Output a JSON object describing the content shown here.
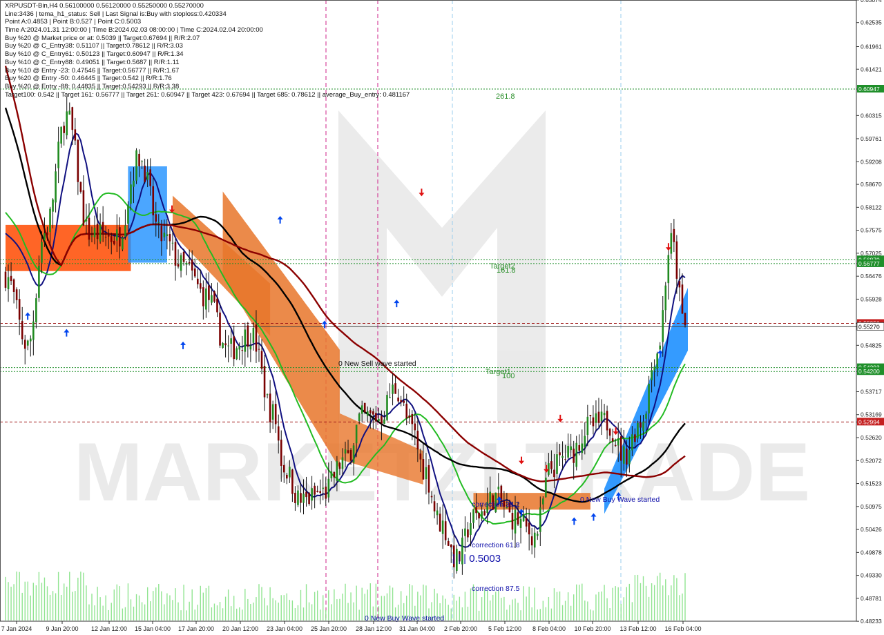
{
  "header": {
    "lines": [
      "XRPUSDT-Bin,H4  0.56100000 0.56120000 0.55250000 0.55270000",
      "Line:3436 | tema_h1_status: Sell | Last Signal is:Buy with stoploss:0.420334",
      "Point A:0.4853 | Point B:0.527 | Point C:0.5003",
      "Time A:2024.01.31 12:00:00 | Time B:2024.02.03 08:00:00 | Time C:2024.02.04 20:00:00",
      "Buy %20 @ Market price or at: 0.5039 || Target:0.67694 || R/R:2.07",
      "Buy %20 @ C_Entry38: 0.51107 || Target:0.78612 || R/R:3.03",
      "Buy %10 @ C_Entry61: 0.50123 || Target:0.60947 || R/R:1.34",
      "Buy %10 @ C_Entry88: 0.49051 || Target:0.5687 || R/R:1.11",
      "Buy %10 @ Entry -23: 0.47546 || Target:0.56777 || R/R:1.67",
      "Buy %20 @ Entry -50: 0.46445 || Target:0.542 || R/R:1.76",
      "Buy %20 @ Entry -88: 0.44835 || Target:0.54293 || R/R:3.38",
      "Target100: 0.542 || Target 161: 0.56777 || Target 261: 0.60947 || Target 423: 0.67694 || Target 685: 0.78612 || average_Buy_entry: 0.481167"
    ]
  },
  "chart_data": {
    "type": "candlestick",
    "symbol": "XRPUSDT-Bin",
    "timeframe": "H4",
    "ohlc_last": {
      "open": 0.561,
      "high": 0.5612,
      "low": 0.5525,
      "close": 0.5527
    },
    "ylim": [
      0.48235,
      0.63074
    ],
    "y_ticks": [
      "0.63074",
      "0.62535",
      "0.61961",
      "0.61421",
      "0.60947",
      "0.60315",
      "0.59761",
      "0.59208",
      "0.58670",
      "0.58122",
      "0.57575",
      "0.57025",
      "0.56777",
      "0.56476",
      "0.55928",
      "0.55350",
      "0.55270",
      "0.54825",
      "0.54293",
      "0.54200",
      "0.53717",
      "0.53169",
      "0.52994",
      "0.52620",
      "0.52072",
      "0.51523",
      "0.50975",
      "0.50426",
      "0.49878",
      "0.49330",
      "0.48781",
      "0.48233"
    ],
    "x_labels": [
      "7 Jan 2024",
      "9 Jan 20:00",
      "12 Jan 12:00",
      "15 Jan 04:00",
      "17 Jan 20:00",
      "20 Jan 12:00",
      "23 Jan 04:00",
      "25 Jan 20:00",
      "28 Jan 12:00",
      "31 Jan 04:00",
      "2 Feb 20:00",
      "5 Feb 12:00",
      "8 Feb 04:00",
      "10 Feb 20:00",
      "13 Feb 12:00",
      "16 Feb 04:00"
    ],
    "price_lines": [
      {
        "value": 0.60947,
        "label": "0.60947",
        "color": "#1f8f2a",
        "style": "dotted",
        "tag": "261.8"
      },
      {
        "value": 0.5687,
        "label": "0.56870",
        "color": "#1f8f2a",
        "style": "dotted",
        "tag": "Target2"
      },
      {
        "value": 0.56777,
        "label": "0.56777",
        "color": "#1f8f2a",
        "style": "dotted",
        "tag": "161.8"
      },
      {
        "value": 0.5535,
        "label": "0.55350",
        "color": "#a01818",
        "style": "dashed"
      },
      {
        "value": 0.5527,
        "label": "0.55270",
        "color": "#444444",
        "style": "solid"
      },
      {
        "value": 0.54293,
        "label": "0.54293",
        "color": "#1f8f2a",
        "style": "dotted",
        "tag": "Target1"
      },
      {
        "value": 0.542,
        "label": "0.54200",
        "color": "#1f8f2a",
        "style": "dotted",
        "tag": "100"
      },
      {
        "value": 0.52994,
        "label": "0.52994",
        "color": "#a01818",
        "style": "dashed"
      }
    ],
    "annotations": [
      {
        "text": "0 New Sell wave started",
        "color": "#111111"
      },
      {
        "text": "0 New Buy Wave started",
        "color": "#1010aa"
      },
      {
        "text": "0 New Buy Wave started",
        "color": "#1010aa"
      },
      {
        "text": "correction 38.2",
        "color": "#1010aa"
      },
      {
        "text": "correction 61.8",
        "color": "#1010aa"
      },
      {
        "text": "correction 87.5",
        "color": "#1010aa"
      },
      {
        "text": "| | | 0.5003",
        "color": "#1010aa"
      }
    ],
    "ma_colors": {
      "green": "#22bb22",
      "navy": "#101080",
      "black": "#000000",
      "maroon": "#8b0000"
    },
    "cloud_colors": {
      "sell": "#e8762a",
      "buy": "#1e90ff"
    },
    "watermark": "MARKETZI TRADE"
  }
}
